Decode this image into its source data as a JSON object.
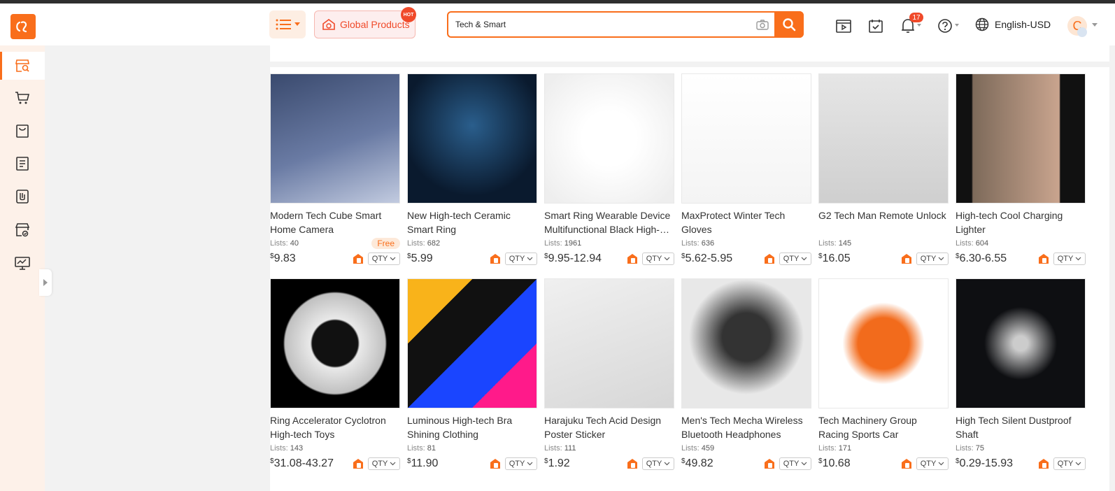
{
  "header": {
    "menu_icon": "list-menu-icon",
    "global_products_label": "Global Products",
    "hot_badge": "HOT",
    "search_value": "Tech & Smart",
    "notification_count": "17",
    "language": "English-USD",
    "avatar_initial": "C"
  },
  "colors": {
    "accent": "#f96e1b",
    "badge": "#f04a2a",
    "sidebar_bg": "#fdf1e9"
  },
  "sidebar": {
    "items": [
      {
        "name": "product-search-icon"
      },
      {
        "name": "cart-icon"
      },
      {
        "name": "shopping-bag-icon"
      },
      {
        "name": "orders-list-icon"
      },
      {
        "name": "sourcing-icon"
      },
      {
        "name": "store-icon"
      },
      {
        "name": "analytics-icon"
      }
    ]
  },
  "products": [
    {
      "name": "Modern Tech Cube Smart Home Camera",
      "lists_label": "Lists:",
      "lists": "40",
      "tag": "Free",
      "currency": "$",
      "price": "9.83",
      "qty_label": "QTY"
    },
    {
      "name": "New High-tech Ceramic Smart Ring",
      "lists_label": "Lists:",
      "lists": "682",
      "currency": "$",
      "price": "5.99",
      "qty_label": "QTY"
    },
    {
      "name": "Smart Ring Wearable Device Multifunctional Black High-tech",
      "lists_label": "Lists:",
      "lists": "1961",
      "currency": "$",
      "price": "9.95-12.94",
      "qty_label": "QTY"
    },
    {
      "name": "MaxProtect Winter Tech Gloves",
      "lists_label": "Lists:",
      "lists": "636",
      "currency": "$",
      "price": "5.62-5.95",
      "qty_label": "QTY"
    },
    {
      "name": "G2 Tech Man Remote Unlock",
      "lists_label": "Lists:",
      "lists": "145",
      "currency": "$",
      "price": "16.05",
      "qty_label": "QTY"
    },
    {
      "name": "High-tech Cool Charging Lighter",
      "lists_label": "Lists:",
      "lists": "604",
      "currency": "$",
      "price": "6.30-6.55",
      "qty_label": "QTY"
    },
    {
      "name": "Ring Accelerator Cyclotron High-tech Toys",
      "lists_label": "Lists:",
      "lists": "143",
      "currency": "$",
      "price": "31.08-43.27",
      "qty_label": "QTY"
    },
    {
      "name": "Luminous High-tech Bra Shining Clothing",
      "lists_label": "Lists:",
      "lists": "81",
      "currency": "$",
      "price": "11.90",
      "qty_label": "QTY"
    },
    {
      "name": "Harajuku Tech Acid Design Poster Sticker",
      "lists_label": "Lists:",
      "lists": "111",
      "currency": "$",
      "price": "1.92",
      "qty_label": "QTY"
    },
    {
      "name": "Men's Tech Mecha Wireless Bluetooth Headphones",
      "lists_label": "Lists:",
      "lists": "459",
      "currency": "$",
      "price": "49.82",
      "qty_label": "QTY"
    },
    {
      "name": "Tech Machinery Group Racing Sports Car",
      "lists_label": "Lists:",
      "lists": "171",
      "currency": "$",
      "price": "10.68",
      "qty_label": "QTY"
    },
    {
      "name": "High Tech Silent Dustproof Shaft",
      "lists_label": "Lists:",
      "lists": "75",
      "currency": "$",
      "price": "0.29-15.93",
      "qty_label": "QTY"
    }
  ]
}
